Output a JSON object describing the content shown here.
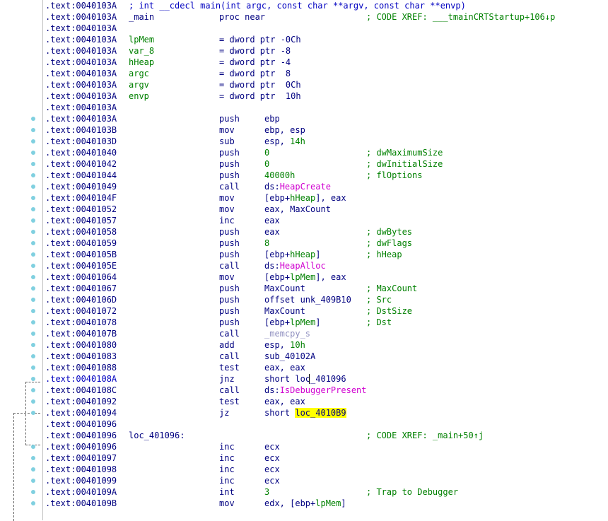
{
  "header": {
    "addr": ".text:0040103A",
    "comment": "; int __cdecl main(int argc, const char **argv, const char **envp)"
  },
  "proc_line": {
    "addr": ".text:0040103A",
    "name": "_main",
    "kw": "proc near",
    "comment": "; CODE XREF: ___tmainCRTStartup+106↓p"
  },
  "vars": [
    {
      "addr": ".text:0040103A",
      "name": "lpMem",
      "eq": "= dword ptr -0Ch"
    },
    {
      "addr": ".text:0040103A",
      "name": "var_8",
      "eq": "= dword ptr -8"
    },
    {
      "addr": ".text:0040103A",
      "name": "hHeap",
      "eq": "= dword ptr -4"
    },
    {
      "addr": ".text:0040103A",
      "name": "argc",
      "eq": "= dword ptr  8"
    },
    {
      "addr": ".text:0040103A",
      "name": "argv",
      "eq": "= dword ptr  0Ch"
    },
    {
      "addr": ".text:0040103A",
      "name": "envp",
      "eq": "= dword ptr  10h"
    }
  ],
  "blank1": ".text:0040103A",
  "instructions": [
    {
      "addr": ".text:0040103A",
      "mnem": "push",
      "ops": "ebp",
      "cmt": ""
    },
    {
      "addr": ".text:0040103B",
      "mnem": "mov",
      "ops": "ebp, esp",
      "cmt": ""
    },
    {
      "addr": ".text:0040103D",
      "mnem": "sub",
      "ops": "esp, 14h",
      "cmt": ""
    },
    {
      "addr": ".text:00401040",
      "mnem": "push",
      "ops": "0",
      "cmt": "; dwMaximumSize"
    },
    {
      "addr": ".text:00401042",
      "mnem": "push",
      "ops": "0",
      "cmt": "; dwInitialSize"
    },
    {
      "addr": ".text:00401044",
      "mnem": "push",
      "ops": "40000h",
      "cmt": "; flOptions"
    },
    {
      "addr": ".text:00401049",
      "mnem": "call",
      "ops": "ds:HeapCreate",
      "cmt": ""
    },
    {
      "addr": ".text:0040104F",
      "mnem": "mov",
      "ops": "[ebp+hHeap], eax",
      "cmt": ""
    },
    {
      "addr": ".text:00401052",
      "mnem": "mov",
      "ops": "eax, MaxCount",
      "cmt": ""
    },
    {
      "addr": ".text:00401057",
      "mnem": "inc",
      "ops": "eax",
      "cmt": ""
    },
    {
      "addr": ".text:00401058",
      "mnem": "push",
      "ops": "eax",
      "cmt": "; dwBytes"
    },
    {
      "addr": ".text:00401059",
      "mnem": "push",
      "ops": "8",
      "cmt": "; dwFlags"
    },
    {
      "addr": ".text:0040105B",
      "mnem": "push",
      "ops": "[ebp+hHeap]",
      "cmt": "; hHeap"
    },
    {
      "addr": ".text:0040105E",
      "mnem": "call",
      "ops": "ds:HeapAlloc",
      "cmt": ""
    },
    {
      "addr": ".text:00401064",
      "mnem": "mov",
      "ops": "[ebp+lpMem], eax",
      "cmt": ""
    },
    {
      "addr": ".text:00401067",
      "mnem": "push",
      "ops": "MaxCount",
      "cmt": "; MaxCount"
    },
    {
      "addr": ".text:0040106D",
      "mnem": "push",
      "ops": "offset unk_409B10",
      "cmt": "; Src"
    },
    {
      "addr": ".text:00401072",
      "mnem": "push",
      "ops": "MaxCount",
      "cmt": "; DstSize"
    },
    {
      "addr": ".text:00401078",
      "mnem": "push",
      "ops": "[ebp+lpMem]",
      "cmt": "; Dst"
    },
    {
      "addr": ".text:0040107B",
      "mnem": "call",
      "ops": "_memcpy_s",
      "cmt": ""
    },
    {
      "addr": ".text:00401080",
      "mnem": "add",
      "ops": "esp, 10h",
      "cmt": ""
    },
    {
      "addr": ".text:00401083",
      "mnem": "call",
      "ops": "sub_40102A",
      "cmt": ""
    },
    {
      "addr": ".text:00401088",
      "mnem": "test",
      "ops": "eax, eax",
      "cmt": ""
    },
    {
      "addr": ".text:0040108A",
      "mnem": "jnz",
      "ops": "short loc_401096",
      "cmt": ""
    },
    {
      "addr": ".text:0040108C",
      "mnem": "call",
      "ops": "ds:IsDebuggerPresent",
      "cmt": ""
    },
    {
      "addr": ".text:00401092",
      "mnem": "test",
      "ops": "eax, eax",
      "cmt": ""
    },
    {
      "addr": ".text:00401094",
      "mnem": "jz",
      "ops": "short loc_4010B9",
      "cmt": ""
    }
  ],
  "blank2": ".text:00401096",
  "loc_line": {
    "addr": ".text:00401096",
    "label": "loc_401096:",
    "comment": "; CODE XREF: _main+50↑j"
  },
  "instructions2": [
    {
      "addr": ".text:00401096",
      "mnem": "inc",
      "ops": "ecx",
      "cmt": ""
    },
    {
      "addr": ".text:00401097",
      "mnem": "inc",
      "ops": "ecx",
      "cmt": ""
    },
    {
      "addr": ".text:00401098",
      "mnem": "inc",
      "ops": "ecx",
      "cmt": ""
    },
    {
      "addr": ".text:00401099",
      "mnem": "inc",
      "ops": "ecx",
      "cmt": ""
    },
    {
      "addr": ".text:0040109A",
      "mnem": "int",
      "ops": "3",
      "cmt": "; Trap to Debugger"
    },
    {
      "addr": ".text:0040109B",
      "mnem": "mov",
      "ops": "edx, [ebp+lpMem]",
      "cmt": ""
    }
  ],
  "colors": {
    "address": "#000080",
    "comment": "#008000",
    "import": "#d000d0",
    "highlight": "#ffff00",
    "breakpoint-dot": "#80d0e0"
  }
}
